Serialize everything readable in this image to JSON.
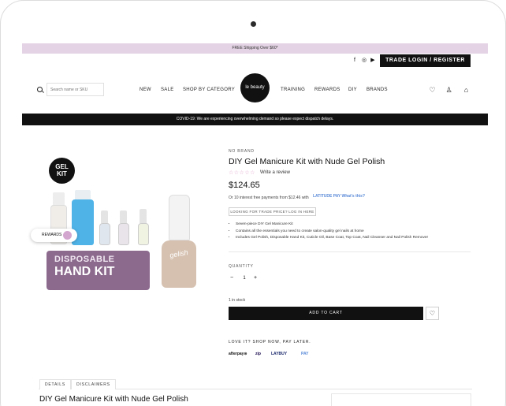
{
  "promo": {
    "text": "FREE Shipping Over $60*"
  },
  "util": {
    "trade_login": "TRADE LOGIN / REGISTER"
  },
  "header": {
    "search_placeholder": "Search name or SKU",
    "logo": "le beauty",
    "nav_left": [
      "NEW",
      "SALE",
      "SHOP BY CATEGORY"
    ],
    "nav_right": [
      "TRAINING",
      "REWARDS",
      "DIY",
      "BRANDS"
    ]
  },
  "covid": {
    "text": "COVID-19: We are experiencing overwhelming demand so please expect dispatch delays."
  },
  "gallery": {
    "badge_line1": "GEL",
    "badge_line2": "KIT",
    "pack_line1": "DISPOSABLE",
    "pack_line2": "HAND KIT",
    "gelish_label": "gelish",
    "rewards_label": "REWARDS"
  },
  "product": {
    "brand": "NO BRAND",
    "title": "DIY Gel Manicure Kit with Nude Gel Polish",
    "stars": "☆☆☆☆☆",
    "review_link": "Write a review",
    "price": "$124.65",
    "installments": "Or 10 interest free payments from $12.46 with",
    "latitude": "LATITUDE PAY  What's this?",
    "trade_button": "LOOKING FOR TRADE PRICE? LOG IN HERE",
    "bullets": [
      "Seven-piece DIY Gel Manicure Kit",
      "Contains all the essentials you need to create salon-quality gel nails at home",
      "Includes Gel Polish, Disposable Hand Kit, Cuticle Oil, Base Coat, Top Coat, Nail Cleanser and Nail Polish Remover"
    ],
    "quantity_label": "QUANTITY",
    "quantity": "1",
    "stock": "1 in stock",
    "add_to_cart": "ADD TO CART",
    "love_it": "LOVE IT? SHOP NOW, PAY LATER.",
    "pay_options": [
      "afterpay⊛",
      "zip",
      "LAYBUY",
      "PAY"
    ]
  },
  "tabs": [
    "DETAILS",
    "DISCLAIMERS"
  ],
  "bottom_title": "DIY Gel Manicure Kit with Nude Gel Polish",
  "colors": {
    "promo_bg": "#e3d3e4",
    "dark": "#111111",
    "star": "#e0a4c9",
    "accent_blue": "#5a8ad8"
  }
}
